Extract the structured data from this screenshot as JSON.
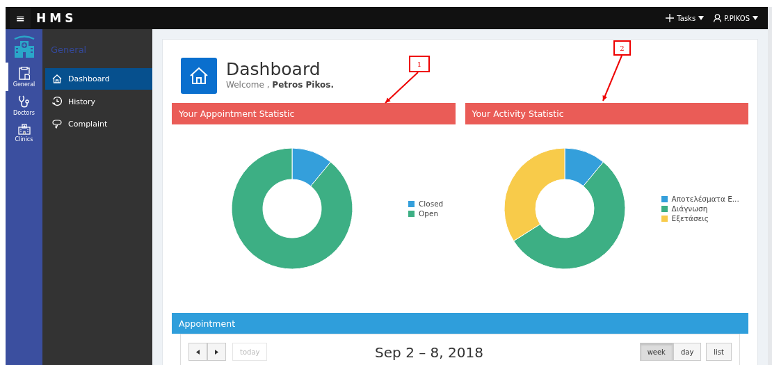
{
  "app": {
    "menu_icon": "≡",
    "title": "HMS"
  },
  "topbar": {
    "tasks": "Tasks",
    "user": "P.PIKOS"
  },
  "rail": [
    {
      "label": "General",
      "selected": true
    },
    {
      "label": "Doctors",
      "selected": false
    },
    {
      "label": "Clinics",
      "selected": false
    }
  ],
  "nav": {
    "heading": "General",
    "items": [
      {
        "label": "Dashboard",
        "selected": true
      },
      {
        "label": "History",
        "selected": false
      },
      {
        "label": "Complaint",
        "selected": false
      }
    ]
  },
  "page": {
    "title": "Dashboard",
    "welcome": "Welcome , **Petros Pikos.**"
  },
  "panels": [
    {
      "title": "Your Appointment Statistic",
      "callout": "1",
      "legend": [
        {
          "label": "Closed",
          "color": "#349fdb"
        },
        {
          "label": "Open",
          "color": "#3daf84"
        }
      ]
    },
    {
      "title": "Your Activity Statistic",
      "callout": "2",
      "legend": [
        {
          "label": "Αποτελέσματα Ε...",
          "color": "#349fdb"
        },
        {
          "label": "Διάγνωση",
          "color": "#3daf84"
        },
        {
          "label": "Εξετάσεις",
          "color": "#f8cb4a"
        }
      ]
    }
  ],
  "calendar": {
    "title": "Appointment",
    "today": "today",
    "range": "Sep 2 – 8, 2018",
    "views": [
      {
        "label": "week",
        "selected": true
      },
      {
        "label": "day",
        "selected": false
      },
      {
        "label": "list",
        "selected": false
      }
    ]
  }
}
